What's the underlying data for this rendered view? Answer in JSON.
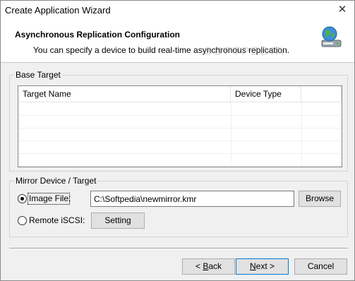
{
  "window": {
    "title": "Create Application Wizard",
    "close": "✕"
  },
  "header": {
    "title": "Asynchronous Replication Configuration",
    "subtitle": "You can specify a device to build real-time asynchronous replication.",
    "watermark": "SOFTPEDIA",
    "icon": "network-drive-globe-icon"
  },
  "base_target": {
    "label": "Base Target",
    "columns": [
      "Target Name",
      "Device Type"
    ],
    "rows": []
  },
  "mirror": {
    "label": "Mirror Device / Target",
    "image_file": {
      "label": "Image File:",
      "value": "C:\\Softpedia\\newmirror.kmr",
      "selected": true
    },
    "browse_label": "Browse",
    "remote_iscsi": {
      "label": "Remote iSCSI:",
      "selected": false
    },
    "setting_label": "Setting"
  },
  "footer": {
    "back": {
      "mnemonic": "B",
      "rest": "ack",
      "prefix": "< "
    },
    "next": {
      "mnemonic": "N",
      "rest": "ext >"
    },
    "cancel": "Cancel"
  }
}
